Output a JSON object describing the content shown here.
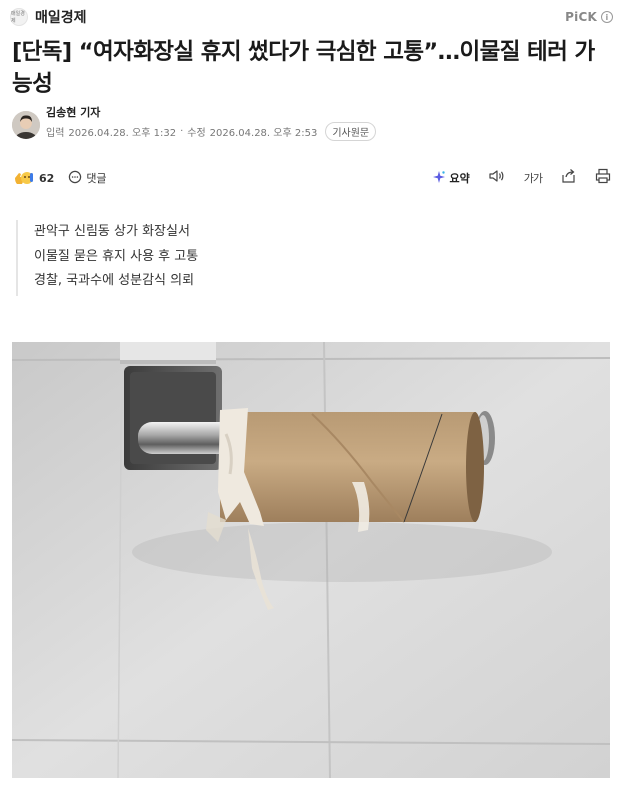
{
  "header": {
    "press_name": "매일경제",
    "press_logo_text": "매일경제",
    "pick_label": "PiCK"
  },
  "article": {
    "headline": "[단독] “여자화장실 휴지 썼다가 극심한 고통”…이물질 테러 가능성",
    "reporter": "김송현 기자",
    "published_label": "입력",
    "published_time": "2026.04.28. 오후 1:32",
    "modified_label": "수정",
    "modified_time": "2026.04.28. 오후 2:53",
    "original_button": "기사원문"
  },
  "actions": {
    "reaction_count": "62",
    "comment_label": "댓글",
    "summary_label": "요약",
    "fontsize_label": "가가"
  },
  "lead": [
    "관악구 신림동 상가 화장실서",
    "이물질 묻은 휴지 사용 후 고통",
    "경찰, 국과수에 성분감식 의뢰"
  ],
  "icons": {
    "reaction": "emoji-reaction-icon",
    "comment": "comment-icon",
    "summary": "sparkle-icon",
    "speaker": "speaker-icon",
    "share": "share-icon",
    "print": "print-icon",
    "info": "info-icon"
  },
  "colors": {
    "text": "#1a1a1a",
    "meta": "#777777",
    "summary_accent": "#5b5ce2"
  }
}
